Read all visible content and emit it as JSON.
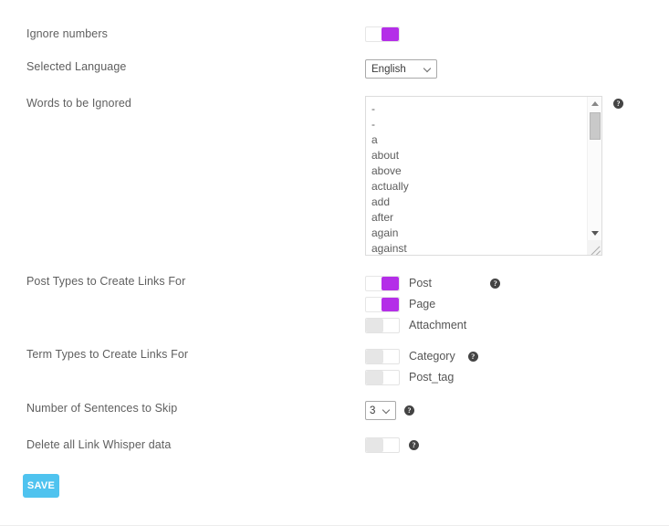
{
  "theme": {
    "accent_purple": "#b42ee8",
    "save_button_bg": "#4fc3ef",
    "label_color": "#5f5f5f",
    "off_track": "#e6e6e6"
  },
  "settings": {
    "ignore_numbers": {
      "label": "Ignore numbers",
      "state": "on"
    },
    "selected_language": {
      "label": "Selected Language",
      "value": "English"
    },
    "words_to_be_ignored": {
      "label": "Words to be Ignored",
      "value": "-\n-\na\nabout\nabove\nactually\nadd\nafter\nagain\nagainst",
      "words": [
        "-",
        "-",
        "a",
        "about",
        "above",
        "actually",
        "add",
        "after",
        "again",
        "against"
      ],
      "help_icon": "help-circle-icon",
      "help_symbol": "?"
    },
    "post_types": {
      "label": "Post Types to Create Links For",
      "help_symbol": "?",
      "items": [
        {
          "label": "Post",
          "state": "on"
        },
        {
          "label": "Page",
          "state": "on"
        },
        {
          "label": "Attachment",
          "state": "off"
        }
      ]
    },
    "term_types": {
      "label": "Term Types to Create Links For",
      "help_symbol": "?",
      "items": [
        {
          "label": "Category",
          "state": "off"
        },
        {
          "label": "Post_tag",
          "state": "off"
        }
      ]
    },
    "sentences_to_skip": {
      "label": "Number of Sentences to Skip",
      "value": "3",
      "help_symbol": "?"
    },
    "delete_all_data": {
      "label": "Delete all Link Whisper data",
      "state": "off",
      "help_symbol": "?"
    }
  },
  "actions": {
    "save_label": "SAVE"
  }
}
